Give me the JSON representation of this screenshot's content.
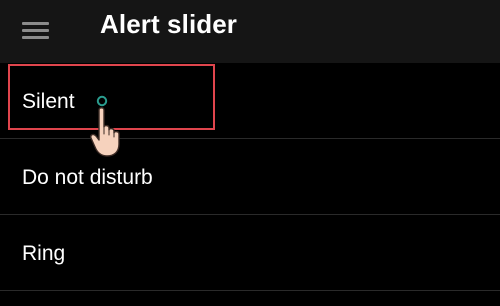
{
  "toolbar": {
    "title": "Alert slider",
    "menu_icon": "hamburger-menu-icon"
  },
  "options": [
    {
      "label": "Silent"
    },
    {
      "label": "Do not disturb"
    },
    {
      "label": "Ring"
    }
  ],
  "annotation": {
    "highlight_color": "#e0454d",
    "pointer_icon": "tap-hand-icon"
  }
}
